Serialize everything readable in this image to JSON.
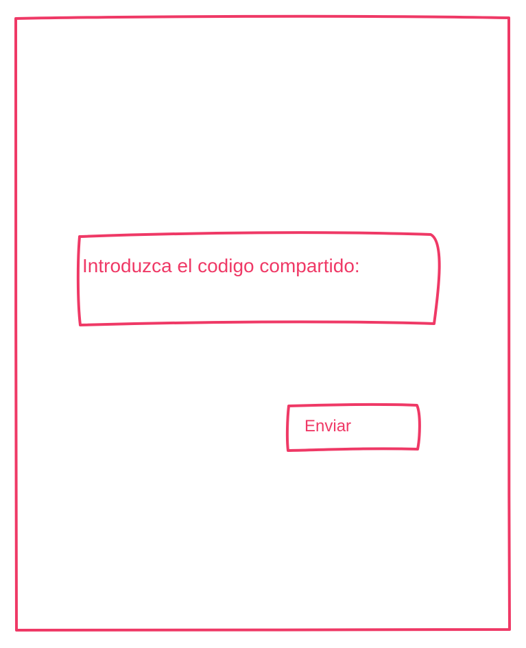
{
  "theme": {
    "accent_color": "#ef3966",
    "background_color": "#ffffff"
  },
  "form": {
    "code_prompt": "Introduzca el codigo compartido:",
    "submit_label": "Enviar"
  }
}
